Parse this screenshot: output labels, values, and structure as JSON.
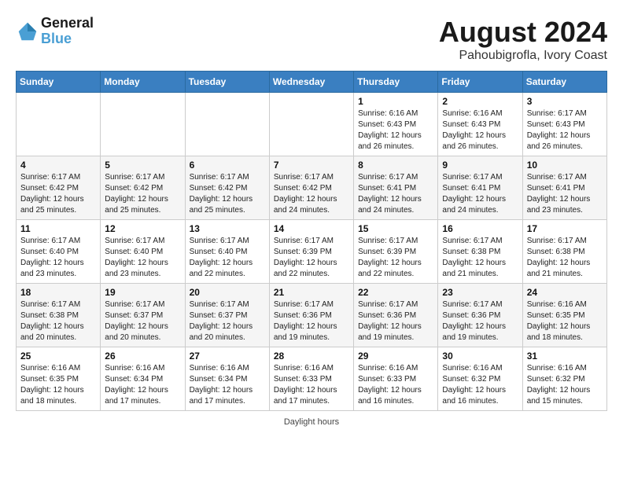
{
  "header": {
    "logo_line1": "General",
    "logo_line2": "Blue",
    "month": "August 2024",
    "location": "Pahoubigrofla, Ivory Coast"
  },
  "days_of_week": [
    "Sunday",
    "Monday",
    "Tuesday",
    "Wednesday",
    "Thursday",
    "Friday",
    "Saturday"
  ],
  "footer": {
    "daylight_note": "Daylight hours"
  },
  "weeks": [
    {
      "days": [
        {
          "num": "",
          "info": ""
        },
        {
          "num": "",
          "info": ""
        },
        {
          "num": "",
          "info": ""
        },
        {
          "num": "",
          "info": ""
        },
        {
          "num": "1",
          "info": "Sunrise: 6:16 AM\nSunset: 6:43 PM\nDaylight: 12 hours\nand 26 minutes."
        },
        {
          "num": "2",
          "info": "Sunrise: 6:16 AM\nSunset: 6:43 PM\nDaylight: 12 hours\nand 26 minutes."
        },
        {
          "num": "3",
          "info": "Sunrise: 6:17 AM\nSunset: 6:43 PM\nDaylight: 12 hours\nand 26 minutes."
        }
      ]
    },
    {
      "days": [
        {
          "num": "4",
          "info": "Sunrise: 6:17 AM\nSunset: 6:42 PM\nDaylight: 12 hours\nand 25 minutes."
        },
        {
          "num": "5",
          "info": "Sunrise: 6:17 AM\nSunset: 6:42 PM\nDaylight: 12 hours\nand 25 minutes."
        },
        {
          "num": "6",
          "info": "Sunrise: 6:17 AM\nSunset: 6:42 PM\nDaylight: 12 hours\nand 25 minutes."
        },
        {
          "num": "7",
          "info": "Sunrise: 6:17 AM\nSunset: 6:42 PM\nDaylight: 12 hours\nand 24 minutes."
        },
        {
          "num": "8",
          "info": "Sunrise: 6:17 AM\nSunset: 6:41 PM\nDaylight: 12 hours\nand 24 minutes."
        },
        {
          "num": "9",
          "info": "Sunrise: 6:17 AM\nSunset: 6:41 PM\nDaylight: 12 hours\nand 24 minutes."
        },
        {
          "num": "10",
          "info": "Sunrise: 6:17 AM\nSunset: 6:41 PM\nDaylight: 12 hours\nand 23 minutes."
        }
      ]
    },
    {
      "days": [
        {
          "num": "11",
          "info": "Sunrise: 6:17 AM\nSunset: 6:40 PM\nDaylight: 12 hours\nand 23 minutes."
        },
        {
          "num": "12",
          "info": "Sunrise: 6:17 AM\nSunset: 6:40 PM\nDaylight: 12 hours\nand 23 minutes."
        },
        {
          "num": "13",
          "info": "Sunrise: 6:17 AM\nSunset: 6:40 PM\nDaylight: 12 hours\nand 22 minutes."
        },
        {
          "num": "14",
          "info": "Sunrise: 6:17 AM\nSunset: 6:39 PM\nDaylight: 12 hours\nand 22 minutes."
        },
        {
          "num": "15",
          "info": "Sunrise: 6:17 AM\nSunset: 6:39 PM\nDaylight: 12 hours\nand 22 minutes."
        },
        {
          "num": "16",
          "info": "Sunrise: 6:17 AM\nSunset: 6:38 PM\nDaylight: 12 hours\nand 21 minutes."
        },
        {
          "num": "17",
          "info": "Sunrise: 6:17 AM\nSunset: 6:38 PM\nDaylight: 12 hours\nand 21 minutes."
        }
      ]
    },
    {
      "days": [
        {
          "num": "18",
          "info": "Sunrise: 6:17 AM\nSunset: 6:38 PM\nDaylight: 12 hours\nand 20 minutes."
        },
        {
          "num": "19",
          "info": "Sunrise: 6:17 AM\nSunset: 6:37 PM\nDaylight: 12 hours\nand 20 minutes."
        },
        {
          "num": "20",
          "info": "Sunrise: 6:17 AM\nSunset: 6:37 PM\nDaylight: 12 hours\nand 20 minutes."
        },
        {
          "num": "21",
          "info": "Sunrise: 6:17 AM\nSunset: 6:36 PM\nDaylight: 12 hours\nand 19 minutes."
        },
        {
          "num": "22",
          "info": "Sunrise: 6:17 AM\nSunset: 6:36 PM\nDaylight: 12 hours\nand 19 minutes."
        },
        {
          "num": "23",
          "info": "Sunrise: 6:17 AM\nSunset: 6:36 PM\nDaylight: 12 hours\nand 19 minutes."
        },
        {
          "num": "24",
          "info": "Sunrise: 6:16 AM\nSunset: 6:35 PM\nDaylight: 12 hours\nand 18 minutes."
        }
      ]
    },
    {
      "days": [
        {
          "num": "25",
          "info": "Sunrise: 6:16 AM\nSunset: 6:35 PM\nDaylight: 12 hours\nand 18 minutes."
        },
        {
          "num": "26",
          "info": "Sunrise: 6:16 AM\nSunset: 6:34 PM\nDaylight: 12 hours\nand 17 minutes."
        },
        {
          "num": "27",
          "info": "Sunrise: 6:16 AM\nSunset: 6:34 PM\nDaylight: 12 hours\nand 17 minutes."
        },
        {
          "num": "28",
          "info": "Sunrise: 6:16 AM\nSunset: 6:33 PM\nDaylight: 12 hours\nand 17 minutes."
        },
        {
          "num": "29",
          "info": "Sunrise: 6:16 AM\nSunset: 6:33 PM\nDaylight: 12 hours\nand 16 minutes."
        },
        {
          "num": "30",
          "info": "Sunrise: 6:16 AM\nSunset: 6:32 PM\nDaylight: 12 hours\nand 16 minutes."
        },
        {
          "num": "31",
          "info": "Sunrise: 6:16 AM\nSunset: 6:32 PM\nDaylight: 12 hours\nand 15 minutes."
        }
      ]
    }
  ]
}
